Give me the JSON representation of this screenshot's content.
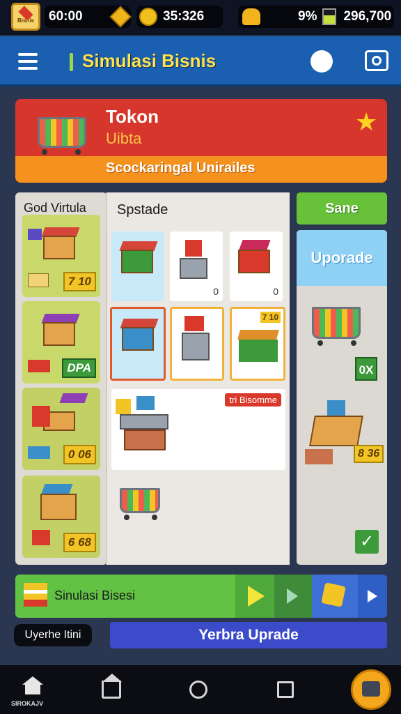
{
  "statusbar": {
    "time": "60:00",
    "coins": "35:326",
    "battery": "9%",
    "cash": "296,700",
    "badge_text": "Bisnis"
  },
  "appbar": {
    "title": "Simulasi Bisnis"
  },
  "store": {
    "name": "Tokon",
    "subtitle": "Uibta",
    "tagline": "Scockaringal Unirailes"
  },
  "left_panel": {
    "title": "God Virtula",
    "cards": [
      {
        "price": "7 10"
      },
      {
        "price": "DPA"
      },
      {
        "price": "0 06"
      },
      {
        "price": "6 68"
      }
    ]
  },
  "mid_panel": {
    "title": "Spstade",
    "row1_badges": [
      "",
      "0",
      "0"
    ],
    "row2_badge": "7 10",
    "promo_label": "tri Bisomme"
  },
  "right_col": {
    "save_label": "Sane",
    "upgrade_label": "Uporade",
    "badge_ok": "0X",
    "price": "8 36"
  },
  "progress": {
    "label": "Sinulasi Bisesi"
  },
  "upgrade_button": "Yerbra Uprade",
  "small_pill": "Uyerhe Itini",
  "nav": {
    "home_label": "SIROKAJV"
  },
  "colors": {
    "appbar": "#1a5fb0",
    "banner_red": "#d7362c",
    "banner_orange": "#f5921e",
    "save_green": "#67c23a",
    "upgrade_blue": "#8fd0f5",
    "fab_orange": "#f4a61c"
  }
}
